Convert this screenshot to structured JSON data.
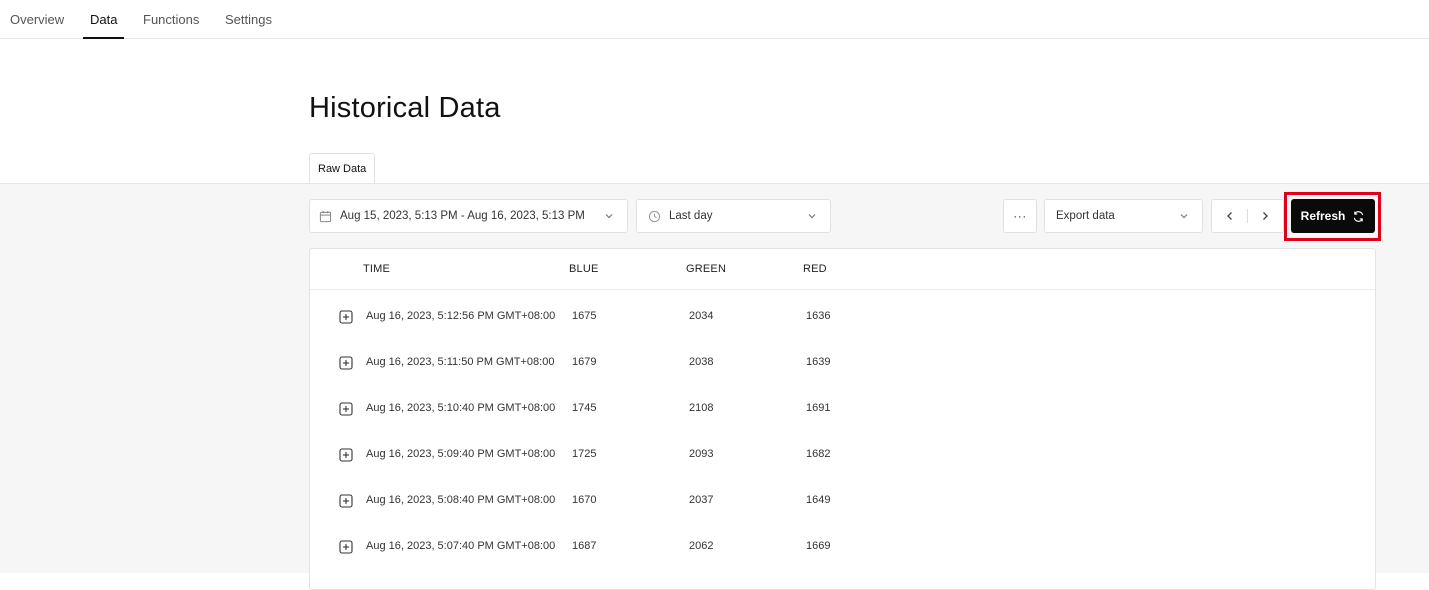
{
  "nav": {
    "tabs": [
      {
        "label": "Overview"
      },
      {
        "label": "Data"
      },
      {
        "label": "Functions"
      },
      {
        "label": "Settings"
      }
    ],
    "active": "Data"
  },
  "page": {
    "title": "Historical Data",
    "sub_tab": "Raw Data"
  },
  "toolbar": {
    "date_range": "Aug 15, 2023, 5:13 PM - Aug 16, 2023, 5:13 PM",
    "period": "Last day",
    "more_label": "···",
    "export_label": "Export data",
    "refresh_label": "Refresh"
  },
  "table": {
    "columns": [
      "TIME",
      "BLUE",
      "GREEN",
      "RED"
    ],
    "rows": [
      {
        "time": "Aug 16, 2023, 5:12:56 PM GMT+08:00",
        "blue": "1675",
        "green": "2034",
        "red": "1636"
      },
      {
        "time": "Aug 16, 2023, 5:11:50 PM GMT+08:00",
        "blue": "1679",
        "green": "2038",
        "red": "1639"
      },
      {
        "time": "Aug 16, 2023, 5:10:40 PM GMT+08:00",
        "blue": "1745",
        "green": "2108",
        "red": "1691"
      },
      {
        "time": "Aug 16, 2023, 5:09:40 PM GMT+08:00",
        "blue": "1725",
        "green": "2093",
        "red": "1682"
      },
      {
        "time": "Aug 16, 2023, 5:08:40 PM GMT+08:00",
        "blue": "1670",
        "green": "2037",
        "red": "1649"
      },
      {
        "time": "Aug 16, 2023, 5:07:40 PM GMT+08:00",
        "blue": "1687",
        "green": "2062",
        "red": "1669"
      }
    ]
  },
  "colors": {
    "highlight": "#e0001a",
    "primary_button": "#0a0a0a",
    "band_background": "#f6f6f6"
  }
}
